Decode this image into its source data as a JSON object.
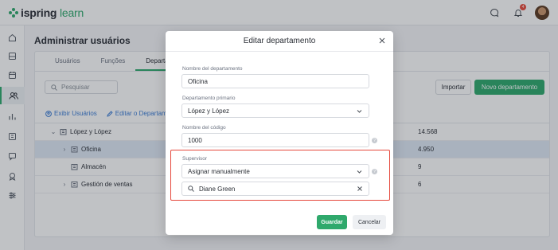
{
  "app": {
    "logo_part1": "ispring",
    "logo_part2": " learn",
    "notification_count": "4"
  },
  "sidebar": {
    "items": [
      {
        "icon": "home-icon"
      },
      {
        "icon": "catalog-icon"
      },
      {
        "icon": "calendar-icon"
      },
      {
        "icon": "users-icon",
        "active": true
      },
      {
        "icon": "reports-icon"
      },
      {
        "icon": "courses-icon"
      },
      {
        "icon": "chat-icon"
      },
      {
        "icon": "achievements-icon"
      },
      {
        "icon": "settings-icon"
      }
    ]
  },
  "page": {
    "title": "Administrar usuários",
    "tabs": [
      "Usuários",
      "Funções",
      "Departamentos"
    ],
    "search_placeholder": "Pesquisar",
    "import_label": "Importar",
    "new_department_label": "Novo departamento",
    "actions": {
      "view_users": "Exibir Usuários",
      "edit_department": "Editar o Departamento"
    },
    "rows": [
      {
        "name": "López y López",
        "value": "14.568"
      },
      {
        "name": "Oficina",
        "value": "4.950"
      },
      {
        "name": "Almacén",
        "value": "9"
      },
      {
        "name": "Gestión de ventas",
        "value": "6"
      }
    ]
  },
  "modal": {
    "title": "Editar departamento",
    "name_label": "Nombre del departamento",
    "name_value": "Oficina",
    "parent_label": "Departamento primario",
    "parent_value": "López y López",
    "code_label": "Nombre del código",
    "code_value": "1000",
    "supervisor_label": "Supervisor",
    "supervisor_mode": "Asignar manualmente",
    "supervisor_value": "Diane Green",
    "save_label": "Guardar",
    "cancel_label": "Cancelar"
  },
  "colors": {
    "brand_green": "#2fa96c",
    "highlight_red": "#e5483c",
    "link_blue": "#3a7bd5"
  }
}
